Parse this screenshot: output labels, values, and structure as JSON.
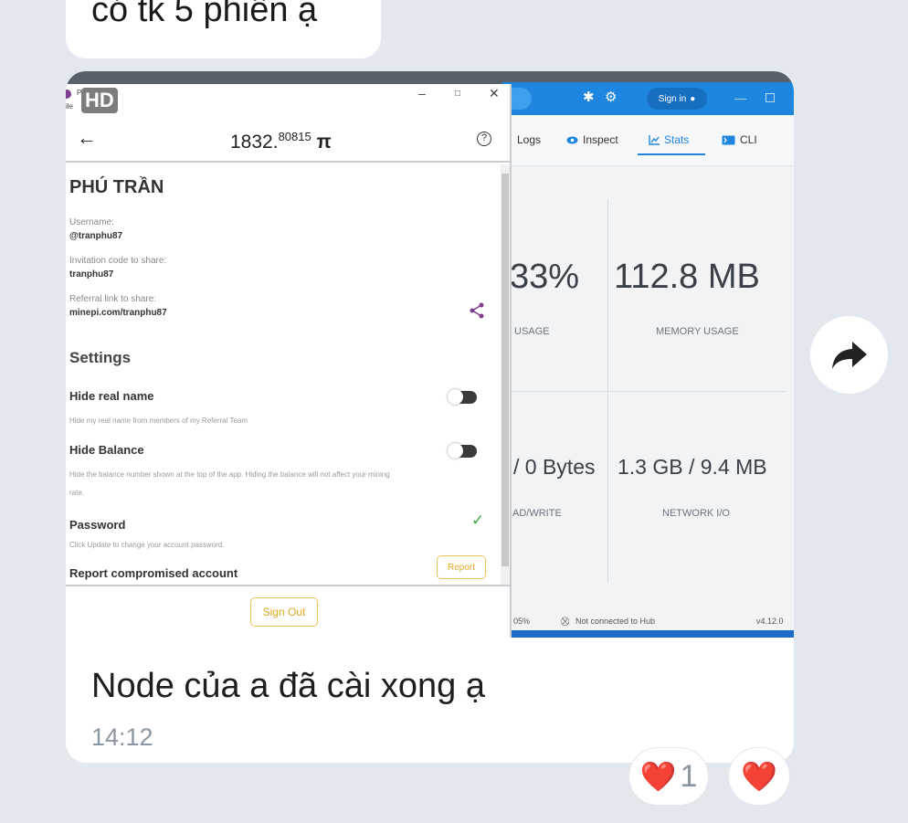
{
  "previous_message": {
    "text": "có tk 5 phiên ạ"
  },
  "message": {
    "hd_badge": "HD",
    "caption": "Node của a đã cài xong ạ",
    "time": "14:12"
  },
  "pi_app": {
    "title_short": "Pi",
    "title_short2": "ile",
    "balance_int": "1832.",
    "balance_dec": "80815",
    "currency": "π",
    "help": "?",
    "name": "PHÚ TRẦN",
    "username_label": "Username:",
    "username_value": "@tranphu87",
    "invite_label": "Invitation code to share:",
    "invite_value": "tranphu87",
    "referral_label": "Referral link to share:",
    "referral_value": "minepi.com/tranphu87",
    "settings_title": "Settings",
    "hide_name_label": "Hide real name",
    "hide_name_desc": "Hide my real name from members of my Referral Team",
    "hide_balance_label": "Hide Balance",
    "hide_balance_desc": "Hide the balance number shown at the top of the app. Hiding the balance will not affect your mining",
    "hide_balance_desc2": "rate.",
    "password_label": "Password",
    "password_desc": "Click Update to change your account password.",
    "report_label": "Report compromised account",
    "report_button": "Report",
    "signout_button": "Sign Out",
    "hide_name_on": false,
    "hide_balance_on": false
  },
  "docker": {
    "signin": "Sign in",
    "tabs": [
      {
        "label": "Logs",
        "icon": "logs-icon"
      },
      {
        "label": "Inspect",
        "icon": "eye-icon"
      },
      {
        "label": "Stats",
        "icon": "chart-icon",
        "active": true
      },
      {
        "label": "CLI",
        "icon": "terminal-icon"
      }
    ],
    "cpu_value": "33%",
    "cpu_caption": "USAGE",
    "mem_value": "112.8 MB",
    "mem_caption": "MEMORY USAGE",
    "disk_value": "/ 0 Bytes",
    "disk_caption": "AD/WRITE",
    "net_value": "1.3 GB / 9.4 MB",
    "net_caption": "NETWORK I/O",
    "status_left": "05%",
    "status_hub": "Not connected to Hub",
    "version": "v4.12.0",
    "accent_color": "#1f86e0"
  },
  "reactions": [
    {
      "emoji": "❤️",
      "count": "1"
    },
    {
      "emoji": "❤️",
      "count": ""
    }
  ]
}
